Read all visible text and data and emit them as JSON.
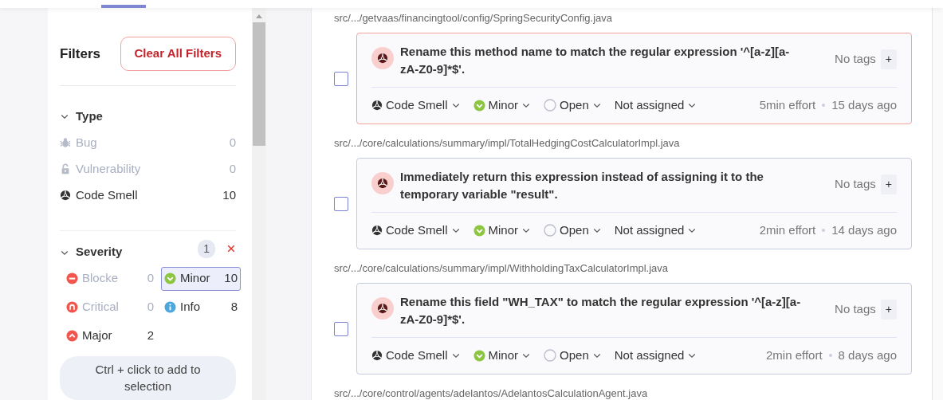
{
  "filters": {
    "title": "Filters",
    "clear_button": "Clear All Filters"
  },
  "type_facet": {
    "title": "Type",
    "expanded": true,
    "items": [
      {
        "kind": "bug",
        "label": "Bug",
        "count": "0",
        "disabled": true
      },
      {
        "kind": "vulnerability",
        "label": "Vulnerability",
        "count": "0",
        "disabled": true
      },
      {
        "kind": "code_smell",
        "label": "Code Smell",
        "count": "10",
        "disabled": false
      }
    ]
  },
  "severity_facet": {
    "title": "Severity",
    "expanded": true,
    "selected_count": "1",
    "items": [
      {
        "kind": "blocker",
        "label": "Blocke",
        "count": "0",
        "selected": false,
        "disabled": true
      },
      {
        "kind": "minor",
        "label": "Minor",
        "count": "10",
        "selected": true,
        "disabled": false
      },
      {
        "kind": "critical",
        "label": "Critical",
        "count": "0",
        "selected": false,
        "disabled": true
      },
      {
        "kind": "info",
        "label": "Info",
        "count": "8",
        "selected": false,
        "disabled": false
      },
      {
        "kind": "major",
        "label": "Major",
        "count": "2",
        "selected": false,
        "disabled": false
      }
    ],
    "hint": "Ctrl + click to add to selection"
  },
  "issues": [
    {
      "path": "src/.../getvaas/financingtool/config/SpringSecurityConfig.java",
      "message": "Rename this method name to match the regular expression '^[a-z][a-zA-Z0-9]*$'.",
      "focused": true,
      "selected": false,
      "tags": "No tags",
      "add_tag": "+",
      "type": "Code Smell",
      "severity": "Minor",
      "status": "Open",
      "assignee": "Not assigned",
      "effort": "5min effort",
      "age": "15 days ago"
    },
    {
      "path": "src/.../core/calculations/summary/impl/TotalHedgingCostCalculatorImpl.java",
      "message": "Immediately return this expression instead of assigning it to the temporary variable \"result\".",
      "focused": false,
      "selected": false,
      "tags": "No tags",
      "add_tag": "+",
      "type": "Code Smell",
      "severity": "Minor",
      "status": "Open",
      "assignee": "Not assigned",
      "effort": "2min effort",
      "age": "14 days ago"
    },
    {
      "path": "src/.../core/calculations/summary/impl/WithholdingTaxCalculatorImpl.java",
      "message": "Rename this field \"WH_TAX\" to match the regular expression '^[a-z][a-zA-Z0-9]*$'.",
      "focused": false,
      "selected": false,
      "tags": "No tags",
      "add_tag": "+",
      "type": "Code Smell",
      "severity": "Minor",
      "status": "Open",
      "assignee": "Not assigned",
      "effort": "2min effort",
      "age": "8 days ago"
    },
    {
      "path": "src/.../core/control/agents/adelantos/AdelantosCalculationAgent.java"
    }
  ]
}
